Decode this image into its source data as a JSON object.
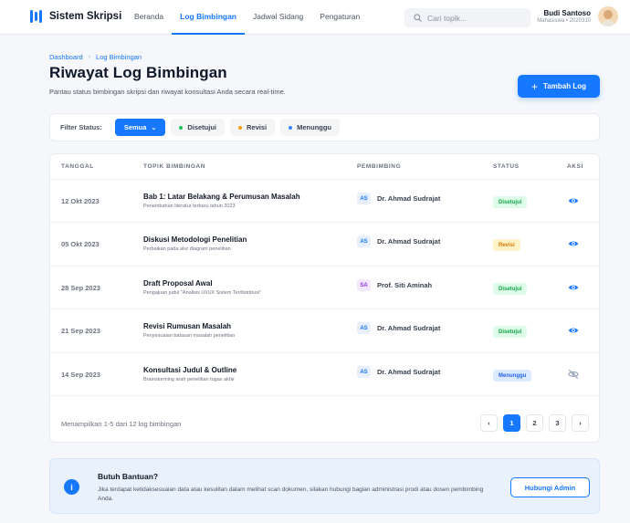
{
  "app": {
    "name": "Sistem Skripsi"
  },
  "nav": {
    "items": [
      {
        "label": "Beranda",
        "active": false
      },
      {
        "label": "Log Bimbingan",
        "active": true
      },
      {
        "label": "Jadwal Sidang",
        "active": false
      },
      {
        "label": "Pengaturan",
        "active": false
      }
    ]
  },
  "search": {
    "placeholder": "Cari topik..."
  },
  "user": {
    "name": "Budi Santoso",
    "role": "Mahasiswa • 2020310"
  },
  "breadcrumb": {
    "root": "Dashboard",
    "separator": "›",
    "current": "Log Bimbingan"
  },
  "page": {
    "title": "Riwayat Log Bimbingan",
    "subtitle": "Pantau status bimbingan skripsi dan riwayat konsultasi Anda secara real-time.",
    "add_button": "Tambah Log"
  },
  "filter": {
    "label": "Filter Status:",
    "options": [
      {
        "label": "Semua",
        "active": true,
        "color": "#1677ff"
      },
      {
        "label": "Disetujui",
        "active": false,
        "color": "#22c55e"
      },
      {
        "label": "Revisi",
        "active": false,
        "color": "#f59e0b"
      },
      {
        "label": "Menunggu",
        "active": false,
        "color": "#3b82f6"
      }
    ]
  },
  "table": {
    "columns": {
      "date": "TANGGAL",
      "topic": "TOPIK BIMBINGAN",
      "advisor": "PEMBIMBING",
      "status": "STATUS",
      "action": "AKSI"
    },
    "rows": [
      {
        "date": "12 Okt 2023",
        "title": "Bab 1: Latar Belakang & Perumusan Masalah",
        "desc": "Penambahan literatur terbaru tahun 2023",
        "initials": "AS",
        "advisor": "Dr. Ahmad Sudrajat",
        "status": "Disetujui",
        "status_type": "approved",
        "action_icon": "eye-icon"
      },
      {
        "date": "05 Okt 2023",
        "title": "Diskusi Metodologi Penelitian",
        "desc": "Perbaikan pada alur diagram penelitian",
        "initials": "AS",
        "advisor": "Dr. Ahmad Sudrajat",
        "status": "Revisi",
        "status_type": "revision",
        "action_icon": "eye-icon"
      },
      {
        "date": "28 Sep 2023",
        "title": "Draft Proposal Awal",
        "desc": "Pengajuan judul \"Analisis UI/UX Sistem Terdistribusi\"",
        "initials": "SA",
        "advisor": "Prof. Siti Aminah",
        "status": "Disetujui",
        "status_type": "approved",
        "action_icon": "eye-icon"
      },
      {
        "date": "21 Sep 2023",
        "title": "Revisi Rumusan Masalah",
        "desc": "Penyesuaian batasan masalah penelitian",
        "initials": "AS",
        "advisor": "Dr. Ahmad Sudrajat",
        "status": "Disetujui",
        "status_type": "approved",
        "action_icon": "eye-icon"
      },
      {
        "date": "14 Sep 2023",
        "title": "Konsultasi Judul & Outline",
        "desc": "Brainstorming arah penelitian tugas akhir",
        "initials": "AS",
        "advisor": "Dr. Ahmad Sudrajat",
        "status": "Menunggu",
        "status_type": "pending",
        "action_icon": "eye-off-icon"
      }
    ]
  },
  "pagination": {
    "info": "Menampilkan 1-5 dari 12 log bimbingan",
    "prev": "‹",
    "pages": [
      "1",
      "2",
      "3"
    ],
    "current": "1",
    "next": "›"
  },
  "help": {
    "icon": "i",
    "title": "Butuh Bantuan?",
    "text": "Jika terdapat ketidaksesuaian data atau kesulitan dalam melihat scan dokumen, silakan hubungi bagian administrasi prodi atau dosen pembimbing Anda.",
    "button": "Hubungi Admin"
  },
  "colors": {
    "accent": "#1677ff",
    "approved_bg": "#dcfce7",
    "approved_fg": "#16a34a",
    "revision_bg": "#fef3c7",
    "revision_fg": "#d97706",
    "pending_bg": "#dbeafe",
    "pending_fg": "#2563eb",
    "initials_AS_bg": "#e8f0fe",
    "initials_AS_fg": "#1677ff",
    "initials_SA_bg": "#f3e8ff",
    "initials_SA_fg": "#9333ea"
  }
}
